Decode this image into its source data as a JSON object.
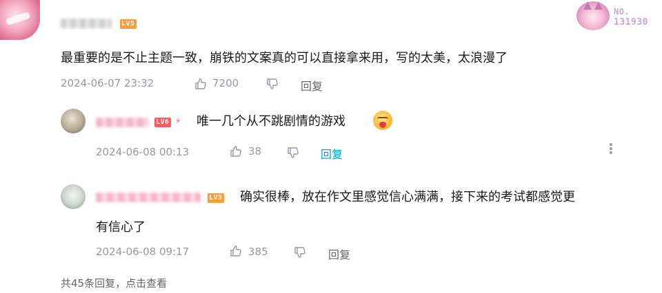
{
  "comment": {
    "level_badge": "LV5",
    "content": "最重要的是不止主题一致，崩铁的文案真的可以直接拿来用，写的太美，太浪漫了",
    "date": "2024-06-07 23:32",
    "likes": "7200",
    "reply_label": "回复",
    "fan_badge": {
      "no_label": "NO.",
      "number": "131930"
    }
  },
  "replies": [
    {
      "level_badge": "LV6",
      "content": "唯一几个从不跳剧情的游戏",
      "emoji": "heart-face-emoji",
      "date": "2024-06-08 00:13",
      "likes": "38",
      "reply_label": "回复"
    },
    {
      "level_badge": "LV5",
      "content_line1": "确实很棒，放在作文里感觉信心满满，接下来的考试都感觉更",
      "content_line2": "有信心了",
      "date": "2024-06-08 09:17",
      "likes": "385",
      "reply_label": "回复"
    }
  ],
  "footer": {
    "total_replies_text": "共45条回复，点击查看"
  },
  "colors": {
    "text_primary": "#18191c",
    "text_meta": "#9499a0",
    "reply_active": "#0c9cd8",
    "level5": "#ff9a3d",
    "level6": "#ff5b5b"
  },
  "icons": [
    "like-icon",
    "dislike-icon",
    "more-icon"
  ]
}
